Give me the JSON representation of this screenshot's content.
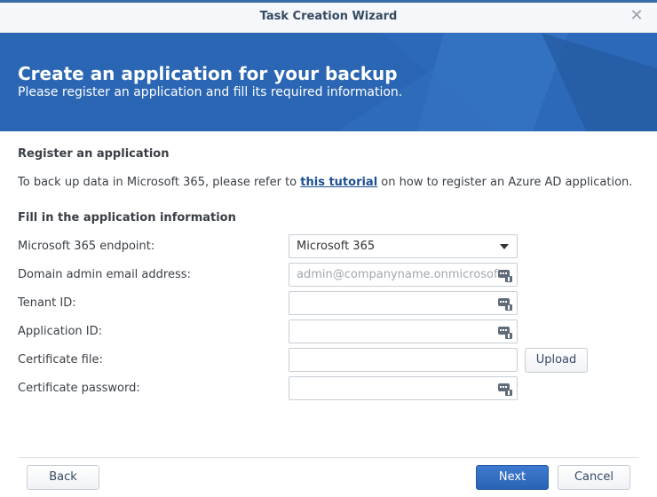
{
  "window": {
    "title": "Task Creation Wizard"
  },
  "banner": {
    "title": "Create an application for your backup",
    "subtitle": "Please register an application and fill its required information."
  },
  "register": {
    "heading": "Register an application",
    "text_before": "To back up data in Microsoft 365, please refer to ",
    "link": "this tutorial",
    "text_after": " on how to register an Azure AD application."
  },
  "form": {
    "heading": "Fill in the application information",
    "endpoint": {
      "label": "Microsoft 365 endpoint:",
      "value": "Microsoft 365"
    },
    "email": {
      "label": "Domain admin email address:",
      "placeholder": "admin@companyname.onmicrosoft.com"
    },
    "tenant": {
      "label": "Tenant ID:",
      "value": ""
    },
    "app_id": {
      "label": "Application ID:",
      "value": ""
    },
    "cert_file": {
      "label": "Certificate file:",
      "value": "",
      "upload": "Upload"
    },
    "cert_password": {
      "label": "Certificate password:",
      "value": ""
    }
  },
  "footer": {
    "back": "Back",
    "next": "Next",
    "cancel": "Cancel"
  },
  "colors": {
    "banner": "#2a66b3",
    "primary": "#2a63b3",
    "link": "#1d4f91"
  }
}
